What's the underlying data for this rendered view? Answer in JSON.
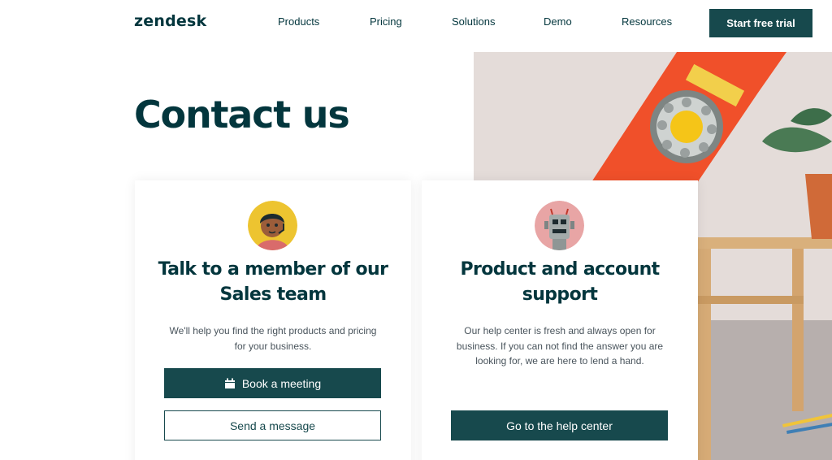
{
  "header": {
    "logo": "zendesk",
    "nav": [
      "Products",
      "Pricing",
      "Solutions",
      "Demo",
      "Resources"
    ],
    "cta_label": "Start free trial"
  },
  "page": {
    "title": "Contact us"
  },
  "sales_card": {
    "title_lines": [
      "Talk to a member of our",
      "Sales team"
    ],
    "desc_lines": [
      "We'll help you find the right products and pricing",
      "for your business."
    ],
    "primary_label": "Book a meeting",
    "secondary_label": "Send a message"
  },
  "support_card": {
    "title_lines": [
      "Product and account",
      "support"
    ],
    "desc_lines": [
      "Our help center is fresh and always open for",
      "business. If you can not find the answer you are",
      "looking for, we are here to lend a hand."
    ],
    "primary_label": "Go to the help center"
  },
  "colors": {
    "brand_dark": "#03363d",
    "button": "#17494d",
    "phone_orange": "#f0502a"
  }
}
